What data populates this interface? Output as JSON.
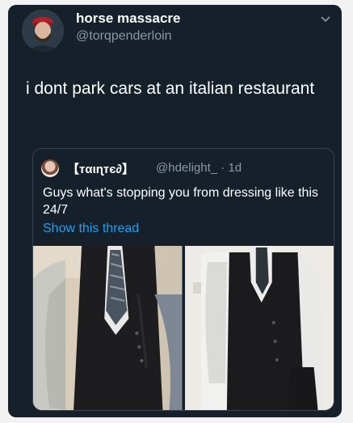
{
  "tweet": {
    "display_name": "horse massacre",
    "handle": "@torqpenderloin",
    "text": "i dont park cars at an italian restaurant",
    "menu_icon": "chevron-down-icon"
  },
  "quoted_tweet": {
    "display_name": "【тαιɳтє∂】",
    "handle_time": "@hdelight_ · 1d",
    "text": "Guys what's stopping you from dressing like this 24/7",
    "link": "Show this thread",
    "images": [
      "vest-photo-left",
      "vest-photo-right"
    ]
  },
  "colors": {
    "background": "#15202b",
    "text": "#ffffff",
    "muted": "#8899a6",
    "link": "#1da1f2",
    "border": "#38444d"
  }
}
